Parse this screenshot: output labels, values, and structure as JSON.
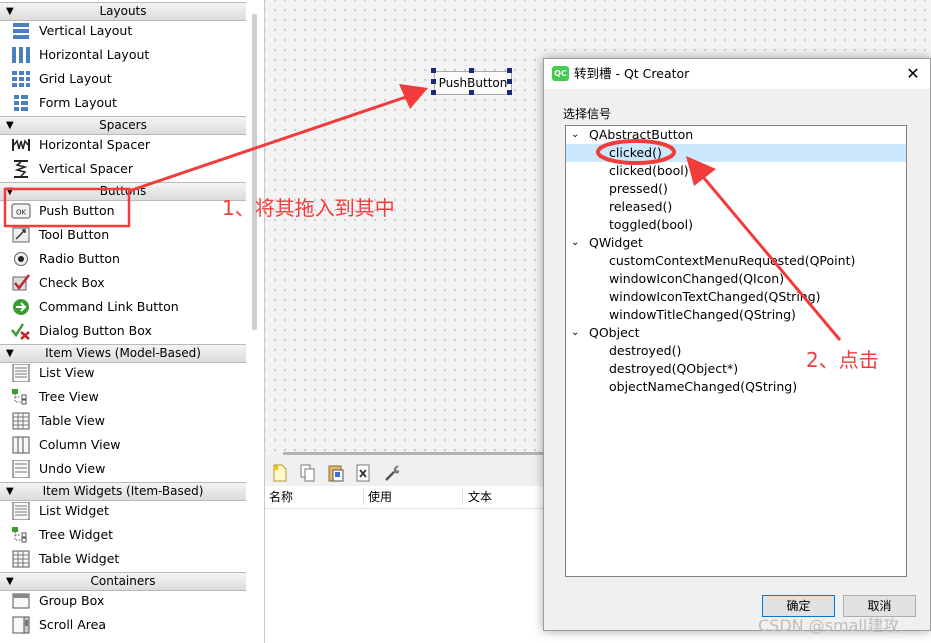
{
  "widget_box": {
    "categories": [
      {
        "label": "Layouts"
      },
      {
        "label": "Spacers"
      },
      {
        "label": "Buttons"
      },
      {
        "label": "Item Views (Model-Based)"
      },
      {
        "label": "Item Widgets (Item-Based)"
      },
      {
        "label": "Containers"
      }
    ],
    "items": [
      {
        "label": "Vertical Layout",
        "icon": "vertical-layout-icon"
      },
      {
        "label": "Horizontal Layout",
        "icon": "horizontal-layout-icon"
      },
      {
        "label": "Grid Layout",
        "icon": "grid-layout-icon"
      },
      {
        "label": "Form Layout",
        "icon": "form-layout-icon"
      },
      {
        "label": "Horizontal Spacer",
        "icon": "horizontal-spacer-icon"
      },
      {
        "label": "Vertical Spacer",
        "icon": "vertical-spacer-icon"
      },
      {
        "label": "Push Button",
        "icon": "push-button-icon"
      },
      {
        "label": "Tool Button",
        "icon": "tool-button-icon"
      },
      {
        "label": "Radio Button",
        "icon": "radio-button-icon"
      },
      {
        "label": "Check Box",
        "icon": "check-box-icon"
      },
      {
        "label": "Command Link Button",
        "icon": "command-link-icon"
      },
      {
        "label": "Dialog Button Box",
        "icon": "dialog-button-box-icon"
      },
      {
        "label": "List View",
        "icon": "list-view-icon"
      },
      {
        "label": "Tree View",
        "icon": "tree-view-icon"
      },
      {
        "label": "Table View",
        "icon": "table-view-icon"
      },
      {
        "label": "Column View",
        "icon": "column-view-icon"
      },
      {
        "label": "Undo View",
        "icon": "undo-view-icon"
      },
      {
        "label": "List Widget",
        "icon": "list-widget-icon"
      },
      {
        "label": "Tree Widget",
        "icon": "tree-widget-icon"
      },
      {
        "label": "Table Widget",
        "icon": "table-widget-icon"
      },
      {
        "label": "Group Box",
        "icon": "group-box-icon"
      },
      {
        "label": "Scroll Area",
        "icon": "scroll-area-icon"
      }
    ]
  },
  "canvas": {
    "push_button_text": "PushButton"
  },
  "action_editor": {
    "toolbar_icons": [
      "new-action-icon",
      "copy-action-icon",
      "paste-action-icon",
      "delete-action-icon",
      "configure-icon"
    ],
    "columns": [
      "名称",
      "使用",
      "文本"
    ]
  },
  "dialog": {
    "title": "转到槽 - Qt Creator",
    "logo_text": "QC",
    "close_glyph": "✕",
    "group_label": "选择信号",
    "tree": [
      {
        "type": "class",
        "label": "QAbstractButton"
      },
      {
        "type": "signal",
        "label": "clicked()",
        "selected": true
      },
      {
        "type": "signal",
        "label": "clicked(bool)"
      },
      {
        "type": "signal",
        "label": "pressed()"
      },
      {
        "type": "signal",
        "label": "released()"
      },
      {
        "type": "signal",
        "label": "toggled(bool)"
      },
      {
        "type": "class",
        "label": "QWidget"
      },
      {
        "type": "signal",
        "label": "customContextMenuRequested(QPoint)"
      },
      {
        "type": "signal",
        "label": "windowIconChanged(QIcon)"
      },
      {
        "type": "signal",
        "label": "windowIconTextChanged(QString)"
      },
      {
        "type": "signal",
        "label": "windowTitleChanged(QString)"
      },
      {
        "type": "class",
        "label": "QObject"
      },
      {
        "type": "signal",
        "label": "destroyed()"
      },
      {
        "type": "signal",
        "label": "destroyed(QObject*)"
      },
      {
        "type": "signal",
        "label": "objectNameChanged(QString)"
      }
    ],
    "ok_label": "确定",
    "cancel_label": "取消"
  },
  "annotations": {
    "step1": "1、将其拖入到其中",
    "step2": "2、点击",
    "color": "#f23b3b"
  },
  "watermark": "CSDN @small建攻"
}
